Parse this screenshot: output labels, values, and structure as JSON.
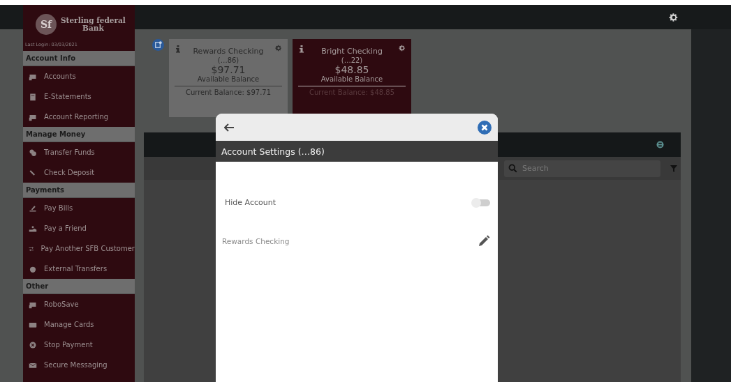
{
  "sidebar": {
    "logo": {
      "monogram": "Sf",
      "name": "Sterling federal",
      "name_line2": "Bank"
    },
    "last_login": "Last Login: 03/03/2021",
    "sections": [
      {
        "title": "Account Info",
        "items": [
          {
            "label": "Accounts"
          },
          {
            "label": "E-Statements"
          },
          {
            "label": "Account Reporting"
          }
        ]
      },
      {
        "title": "Manage Money",
        "items": [
          {
            "label": "Transfer Funds"
          },
          {
            "label": "Check Deposit"
          }
        ]
      },
      {
        "title": "Payments",
        "items": [
          {
            "label": "Pay Bills"
          },
          {
            "label": "Pay a Friend"
          },
          {
            "label": "Pay Another SFB Customer"
          },
          {
            "label": "External Transfers"
          }
        ]
      },
      {
        "title": "Other",
        "items": [
          {
            "label": "RoboSave"
          },
          {
            "label": "Manage Cards"
          },
          {
            "label": "Stop Payment"
          },
          {
            "label": "Secure Messaging"
          }
        ]
      }
    ]
  },
  "accounts": [
    {
      "name": "Rewards Checking",
      "number": "(…86)",
      "balance": "$97.71",
      "balance_label": "Available Balance",
      "current_balance": "Current Balance: $97.71",
      "selected": false
    },
    {
      "name": "Bright Checking",
      "number": "(…22)",
      "balance": "$48.85",
      "balance_label": "Available Balance",
      "current_balance": "Current Balance: $48.85",
      "selected": true
    }
  ],
  "panel": {
    "search": {
      "placeholder": "Search"
    }
  },
  "modal": {
    "title": "Account Settings (…86)",
    "settings": [
      {
        "kind": "toggle",
        "label": "Hide Account",
        "on": false
      },
      {
        "kind": "editable",
        "label": "Rewards Checking"
      }
    ]
  }
}
